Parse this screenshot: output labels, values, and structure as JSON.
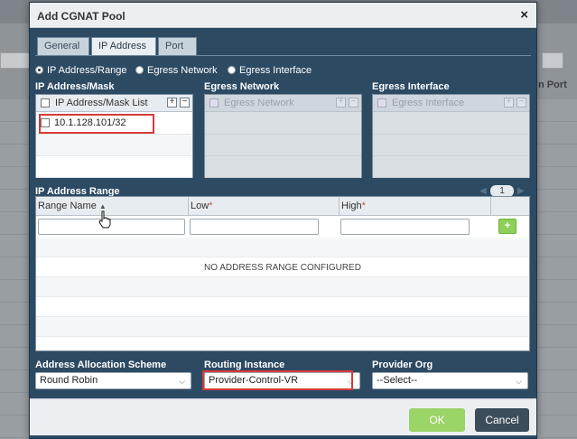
{
  "background": {
    "column_header_fragment": "n Port"
  },
  "dialog": {
    "title": "Add CGNAT Pool",
    "close_glyph": "×",
    "tabs": [
      {
        "label": "General",
        "active": false
      },
      {
        "label": "IP Address",
        "active": true
      },
      {
        "label": "Port",
        "active": false
      }
    ],
    "mode_options": [
      {
        "label": "IP Address/Range",
        "selected": true
      },
      {
        "label": "Egress Network",
        "selected": false
      },
      {
        "label": "Egress Interface",
        "selected": false
      }
    ],
    "ip_mask": {
      "section_label": "IP Address/Mask",
      "list_header": "IP Address/Mask List",
      "entries": [
        "10.1.128.101/32"
      ]
    },
    "egress_network": {
      "section_label": "Egress Network",
      "list_header": "Egress Network"
    },
    "egress_interface": {
      "section_label": "Egress Interface",
      "list_header": "Egress Interface"
    },
    "ip_range": {
      "section_label": "IP Address Range",
      "page": "1",
      "columns": {
        "range_name": "Range Name",
        "low": "Low",
        "high": "High",
        "required_marker": "*"
      },
      "empty_message": "NO ADDRESS RANGE CONFIGURED",
      "add_glyph": "+"
    },
    "allocation": {
      "label": "Address Allocation Scheme",
      "value": "Round Robin"
    },
    "routing": {
      "label": "Routing Instance",
      "value": "Provider-Control-VR"
    },
    "provider_org": {
      "label": "Provider Org",
      "value": "--Select--"
    },
    "buttons": {
      "ok": "OK",
      "cancel": "Cancel"
    }
  },
  "colors": {
    "dialog_body": "#2d4a63",
    "ok_button": "#9bd467",
    "cancel_button": "#3d4c59",
    "highlight_box": "#d83a3a",
    "add_button": "#8fcf5b"
  }
}
